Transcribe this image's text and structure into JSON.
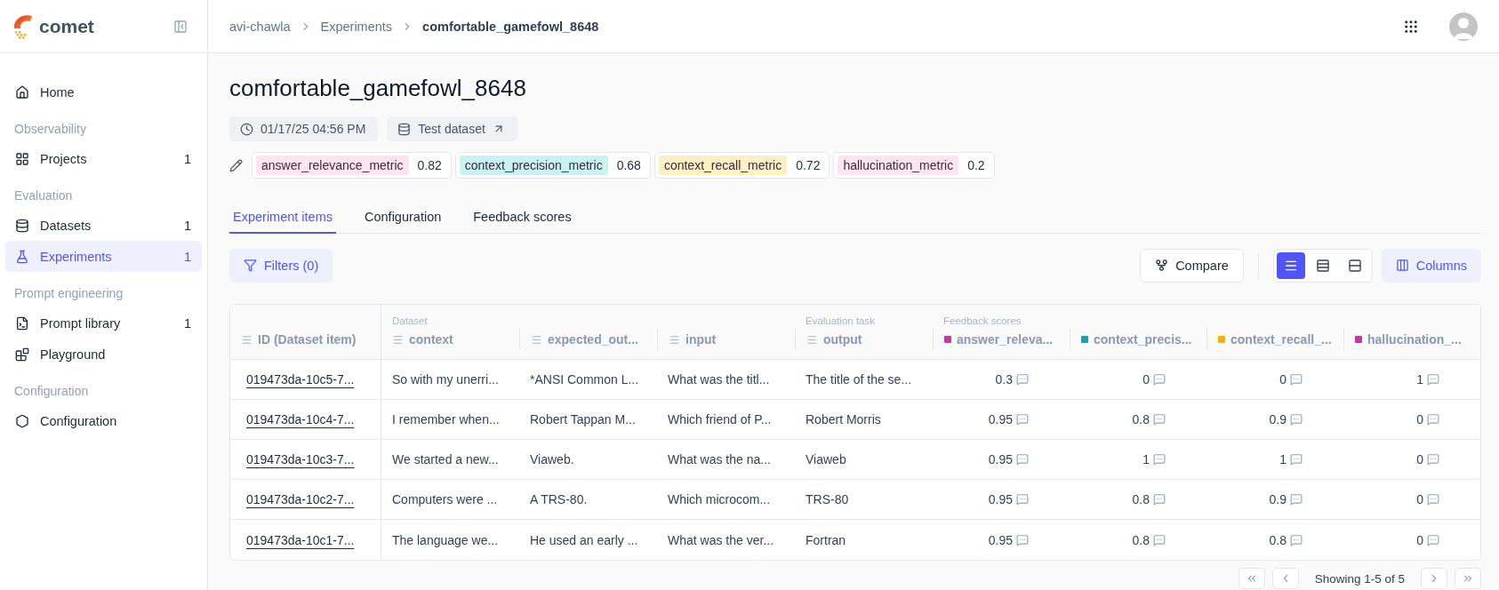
{
  "sidebar": {
    "logo": "comet",
    "sections": [
      {
        "items": [
          {
            "label": "Home",
            "selected": false
          }
        ]
      },
      {
        "title": "Observability",
        "items": [
          {
            "label": "Projects",
            "count": "1",
            "selected": false
          }
        ]
      },
      {
        "title": "Evaluation",
        "items": [
          {
            "label": "Datasets",
            "count": "1",
            "selected": false
          },
          {
            "label": "Experiments",
            "count": "1",
            "selected": true
          }
        ]
      },
      {
        "title": "Prompt engineering",
        "items": [
          {
            "label": "Prompt library",
            "count": "1",
            "selected": false
          },
          {
            "label": "Playground",
            "selected": false
          }
        ]
      },
      {
        "title": "Configuration",
        "items": [
          {
            "label": "Configuration",
            "selected": false
          }
        ]
      }
    ]
  },
  "breadcrumb": [
    "avi-chawla",
    "Experiments",
    "comfortable_gamefowl_8648"
  ],
  "title": "comfortable_gamefowl_8648",
  "meta": [
    {
      "kind": "date",
      "label": "01/17/25 04:56 PM"
    },
    {
      "kind": "dataset",
      "label": "Test dataset"
    }
  ],
  "metrics": [
    {
      "name": "answer_relevance_metric",
      "value": "0.82",
      "color": "#fce4f1"
    },
    {
      "name": "context_precision_metric",
      "value": "0.68",
      "color": "#c9f2f5"
    },
    {
      "name": "context_recall_metric",
      "value": "0.72",
      "color": "#fdf0c4"
    },
    {
      "name": "hallucination_metric",
      "value": "0.2",
      "color": "#fce4f1"
    }
  ],
  "tabs": [
    {
      "label": "Experiment items",
      "selected": true
    },
    {
      "label": "Configuration",
      "selected": false
    },
    {
      "label": "Feedback scores",
      "selected": false
    }
  ],
  "toolbar": {
    "filters": "Filters (0)",
    "compare": "Compare",
    "view_modes": [
      {
        "kind": "compact",
        "selected": true
      },
      {
        "kind": "medium",
        "selected": false
      },
      {
        "kind": "large",
        "selected": false
      }
    ],
    "columns": "Columns"
  },
  "table": {
    "columns": [
      {
        "label": "ID (Dataset item)",
        "kind": "text"
      },
      {
        "label": "context",
        "kind": "text",
        "group": "Dataset"
      },
      {
        "label": "expected_out...",
        "kind": "text"
      },
      {
        "label": "input",
        "kind": "text"
      },
      {
        "label": "output",
        "kind": "text",
        "group": "Evaluation task"
      },
      {
        "label": "answer_releva...",
        "kind": "score",
        "color": "#c13ba1",
        "group": "Feedback scores"
      },
      {
        "label": "context_precis...",
        "kind": "score",
        "color": "#1aa3b0"
      },
      {
        "label": "context_recall_...",
        "kind": "score",
        "color": "#f2b300"
      },
      {
        "label": "hallucination_...",
        "kind": "score",
        "color": "#c13ba1"
      }
    ],
    "rows": [
      [
        "019473da-10c5-7...",
        "So with my unerri...",
        "*ANSI Common L...",
        "What was the titl...",
        "The title of the se...",
        "0.3",
        "0",
        "0",
        "1"
      ],
      [
        "019473da-10c4-7...",
        "I remember when...",
        "Robert Tappan M...",
        "Which friend of P...",
        "Robert Morris",
        "0.95",
        "0.8",
        "0.9",
        "0"
      ],
      [
        "019473da-10c3-7...",
        "We started a new...",
        "Viaweb.",
        "What was the na...",
        "Viaweb",
        "0.95",
        "1",
        "1",
        "0"
      ],
      [
        "019473da-10c2-7...",
        "Computers were ...",
        "A TRS-80.",
        "Which microcom...",
        "TRS-80",
        "0.95",
        "0.8",
        "0.9",
        "0"
      ],
      [
        "019473da-10c1-7...",
        "The language we...",
        "He used an early ...",
        "What was the ver...",
        "Fortran",
        "0.95",
        "0.8",
        "0.8",
        "0"
      ]
    ]
  },
  "pagination": "Showing 1-5 of 5"
}
